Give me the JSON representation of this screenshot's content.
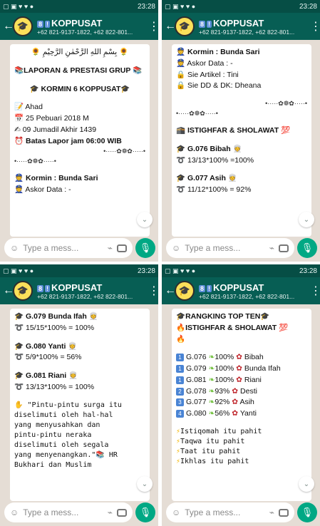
{
  "status": {
    "time": "23:28",
    "left_icons": "▢ ▣ ♥ ♥ ●",
    "right_icons": "⏰ 📶 ▮"
  },
  "header": {
    "badge1": "8",
    "badge2": "!",
    "title": "KOPPUSAT",
    "subtitle": "+62 821-9137-1822, +62 822-801...",
    "menu": "⋮",
    "back": "←"
  },
  "composer": {
    "placeholder": "Type a mess..."
  },
  "panel1": {
    "bismillah": "🌻 بِسْمِ اللهِ الرَّحْمٰنِ الرَّحِيْمِ 🌻",
    "report": "📚LAPORAN & PRESTASI GRUP 📚",
    "kormin": "🎓 KORMIN 6 KOPPUSAT🎓",
    "day": "📝 Ahad",
    "date": "📅 25 Pebuari 2018 M",
    "hijri": "✍ 09 Jumadil Akhir 1439",
    "deadline": "⏰ Batas Lapor jam 06:00 WIB",
    "sep_right": "•·····✿❁✿·····•",
    "sep_left": "•·····✿❁✿·····•",
    "kormin_name": "👮 Kormin : Bunda Sari",
    "askor": "👮 Askor Data : -"
  },
  "panel2": {
    "kormin_name": "👮 Kormin : Bunda Sari",
    "askor": "👮 Askor Data : -",
    "artikel": "🔒 Sie Artikel  : Tini",
    "dd": "🔒 Sie DD & DK: Dheana",
    "sep_right": "•·····✿❁✿·····•",
    "sep_left": "•·····✿❁✿·····•",
    "istighfar": "🕋 ISTIGHFAR & SHOLAWAT 💯",
    "g076": "🎓 G.076 Bibah 👳",
    "g076_score": "➰ 13/13*100% =100%",
    "g077": "🎓 G.077 Asih 👳",
    "g077_score": "➰ 11/12*100% = 92%"
  },
  "panel3": {
    "g079": "🎓 G.079 Bunda Ifah 👳",
    "g079_score": "➰ 15/15*100% = 100%",
    "g080": "🎓 G.080 Yanti 👳",
    "g080_score": "➰ 5/9*100% = 56%",
    "g081": "🎓 G.081 Riani 👳",
    "g081_score": "➰ 13/13*100% = 100%",
    "quote": "✋ \"Pintu-pintu surga itu\ndiselimuti oleh hal-hal\nyang menyusahkan dan\npintu-pintu neraka\ndiselimuti oleh segala\nyang menyenangkan.\"📚 HR\nBukhari dan Muslim"
  },
  "panel4": {
    "rank_title": "🎓RANGKING TOP TEN🎓",
    "istighfar": "🔥ISTIGHFAR & SHOLAWAT 💯",
    "fire": "🔥",
    "rows": [
      {
        "rank": "1",
        "code": "G.076",
        "pct": "100%",
        "name": "Bibah"
      },
      {
        "rank": "1",
        "code": "G.079",
        "pct": "100%",
        "name": "Bunda Ifah"
      },
      {
        "rank": "1",
        "code": "G.081",
        "pct": "100%",
        "name": "Riani"
      },
      {
        "rank": "2",
        "code": "G.078",
        "pct": "93%",
        "name": "Desti"
      },
      {
        "rank": "3",
        "code": "G.077",
        "pct": "92%",
        "name": "Asih"
      },
      {
        "rank": "4",
        "code": "G.080",
        "pct": "56%",
        "name": "Yanti"
      }
    ],
    "lines": [
      "Istiqomah itu pahit",
      "Taqwa itu pahit",
      "Taat itu pahit",
      "Ikhlas itu pahit"
    ]
  },
  "icons": {
    "emoji": "smiley-icon",
    "attach": "paperclip-icon",
    "camera": "camera-icon",
    "mic": "mic-icon",
    "scroll": "chevron-down-icon"
  }
}
